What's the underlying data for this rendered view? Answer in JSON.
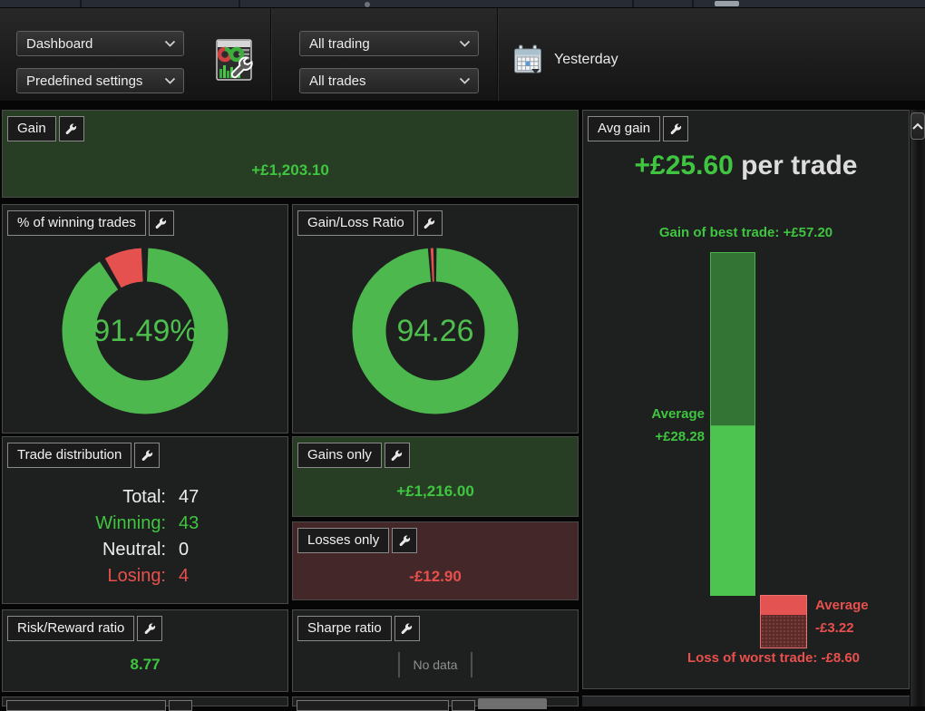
{
  "toolbar": {
    "dashboard_select": {
      "value": "Dashboard"
    },
    "settings_select": {
      "value": "Predefined settings"
    },
    "trading_select": {
      "value": "All trading"
    },
    "trades_select": {
      "value": "All trades"
    },
    "date_filter": {
      "label": "Yesterday"
    }
  },
  "panels": {
    "gain": {
      "title": "Gain",
      "value": "+£1,203.10"
    },
    "winning_pct": {
      "title": "% of winning trades",
      "value": "91.49%"
    },
    "gain_loss_ratio": {
      "title": "Gain/Loss Ratio",
      "value": "94.26"
    },
    "trade_distribution": {
      "title": "Trade distribution",
      "rows": [
        {
          "label": "Total:",
          "value": "47"
        },
        {
          "label": "Winning:",
          "value": "43"
        },
        {
          "label": "Neutral:",
          "value": "0"
        },
        {
          "label": "Losing:",
          "value": "4"
        }
      ]
    },
    "gains_only": {
      "title": "Gains only",
      "value": "+£1,216.00"
    },
    "losses_only": {
      "title": "Losses only",
      "value": "-£12.90"
    },
    "risk_reward": {
      "title": "Risk/Reward ratio",
      "value": "8.77"
    },
    "sharpe": {
      "title": "Sharpe ratio",
      "no_data": "No data"
    },
    "avg_gain": {
      "title": "Avg gain",
      "value": "+£25.60",
      "value_suffix": " per trade",
      "best_label": "Gain of best trade: +£57.20",
      "avg_pos_line1": "Average",
      "avg_pos_line2": "+£28.28",
      "avg_neg_line1": "Average",
      "avg_neg_line2": "-£3.22",
      "worst_label": "Loss of worst trade: -£8.60"
    }
  },
  "colors": {
    "green_text": "#3fc53f",
    "red_text": "#e8504e",
    "donut_green": "#4db84d",
    "donut_red": "#e5514f",
    "bar_bright_green": "#4cc44f",
    "bar_dark_green": "#337334",
    "bar_red": "#e25352"
  },
  "chart_data": [
    {
      "id": "winning_pct_donut",
      "type": "pie",
      "title": "% of winning trades",
      "labels": [
        "Winning",
        "Losing"
      ],
      "values": [
        91.49,
        8.51
      ],
      "colors": [
        "#4db84d",
        "#e5514f"
      ],
      "center_label": "91.49%",
      "donut": true,
      "start_angle_deg": 0,
      "direction": "clockwise"
    },
    {
      "id": "gain_loss_donut",
      "type": "pie",
      "title": "Gain/Loss Ratio",
      "labels": [
        "Gains",
        "Losses"
      ],
      "values": [
        98.95,
        1.05
      ],
      "colors": [
        "#4db84d",
        "#e5514f"
      ],
      "center_label": "94.26",
      "donut": true,
      "start_angle_deg": 0,
      "direction": "clockwise"
    },
    {
      "id": "avg_gain_bar",
      "type": "bar",
      "title": "Avg gain",
      "currency": "GBP",
      "avg_gain_per_trade": 25.6,
      "best_trade": 57.2,
      "average_gain": 28.28,
      "average_loss": -3.22,
      "worst_trade": -8.6,
      "ylim": [
        -8.6,
        57.2
      ]
    },
    {
      "id": "trade_distribution",
      "type": "table",
      "title": "Trade distribution",
      "rows": [
        [
          "Total",
          47
        ],
        [
          "Winning",
          43
        ],
        [
          "Neutral",
          0
        ],
        [
          "Losing",
          4
        ]
      ]
    }
  ]
}
